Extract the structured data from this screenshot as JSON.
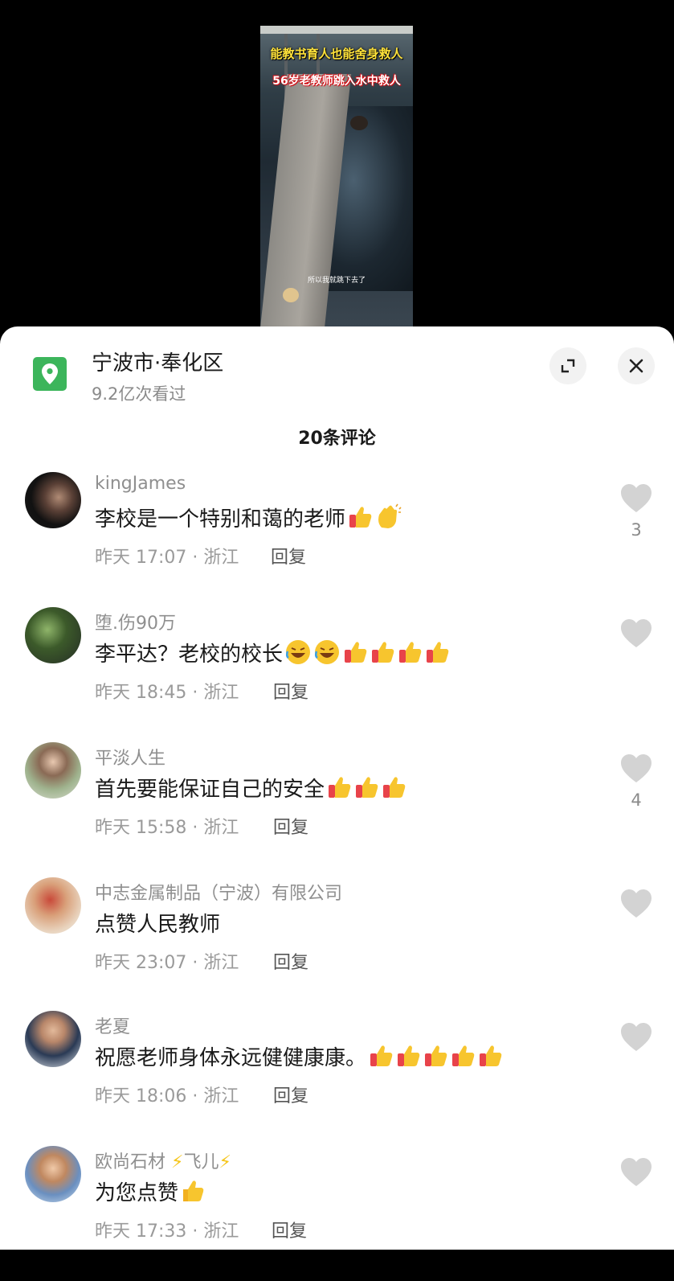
{
  "video": {
    "caption_top": "能教书育人也能舍身救人",
    "caption_red": "56岁老教师跳入水中救人",
    "subtitle": "所以我就跳下去了"
  },
  "header": {
    "location": "宁波市·奉化区",
    "views": "9.2亿次看过",
    "comment_count": "20条评论",
    "icons": [
      "location-pin-icon",
      "expand-icon",
      "close-icon"
    ],
    "accent_color": "#3cb55b"
  },
  "comments": [
    {
      "user": "kingJames",
      "text": "李校是一个特别和蔼的老师",
      "emojis": [
        "thumbs-up",
        "clapping-hands"
      ],
      "time": "昨天 17:07 · 浙江",
      "reply": "回复",
      "likes": "3"
    },
    {
      "user": "堕.伤90万",
      "text": "李平达？老校的校长",
      "emojis": [
        "laughing",
        "laughing",
        "thumbs-up",
        "thumbs-up",
        "thumbs-up",
        "thumbs-up"
      ],
      "time": "昨天 18:45 · 浙江",
      "reply": "回复",
      "likes": ""
    },
    {
      "user": "平淡人生",
      "text": "首先要能保证自己的安全",
      "emojis": [
        "thumbs-up",
        "thumbs-up",
        "thumbs-up"
      ],
      "time": "昨天 15:58 · 浙江",
      "reply": "回复",
      "likes": "4"
    },
    {
      "user": "中志金属制品（宁波）有限公司",
      "text": "点赞人民教师",
      "emojis": [],
      "time": "昨天 23:07 · 浙江",
      "reply": "回复",
      "likes": ""
    },
    {
      "user": "老夏",
      "text": "祝愿老师身体永远健健康康。",
      "emojis": [
        "thumbs-up",
        "thumbs-up",
        "thumbs-up",
        "thumbs-up",
        "thumbs-up"
      ],
      "time": "昨天 18:06 · 浙江",
      "reply": "回复",
      "likes": ""
    },
    {
      "user_parts": [
        "欧尚石材",
        "⚡",
        "飞儿",
        "⚡"
      ],
      "text": "为您点赞",
      "emojis": [
        "thumbs-up-yellow"
      ],
      "time": "昨天 17:33 · 浙江",
      "reply": "回复",
      "likes": ""
    }
  ]
}
